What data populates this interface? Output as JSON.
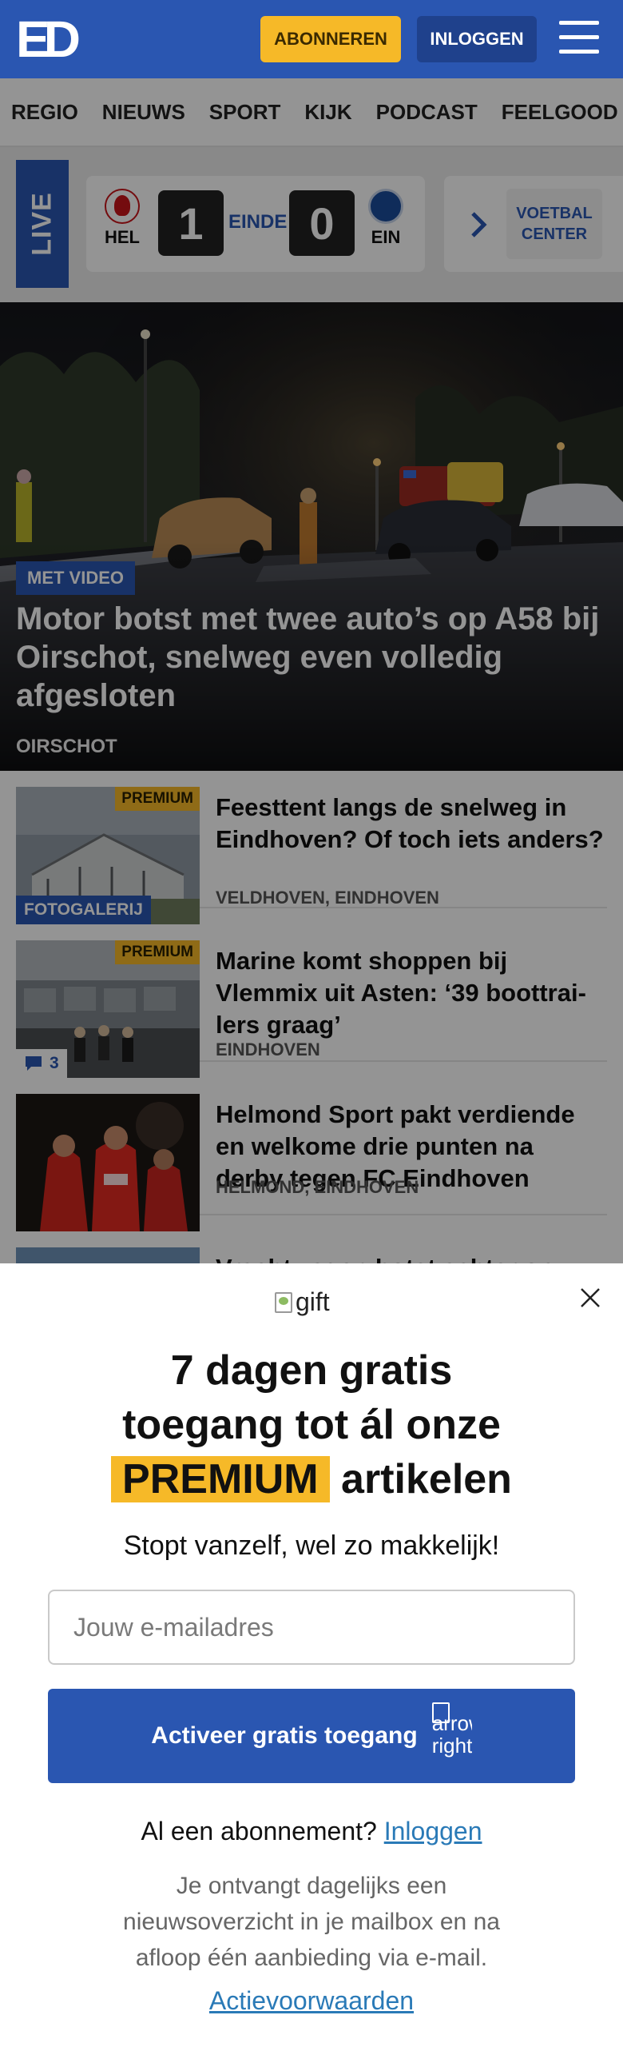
{
  "header": {
    "logo_text": "ED",
    "subscribe_label": "ABONNEREN",
    "login_label": "INLOGGEN",
    "menu_icon": "hamburger-menu-icon"
  },
  "nav": {
    "items": [
      "REGIO",
      "NIEUWS",
      "SPORT",
      "KIJK",
      "PODCAST",
      "FEELGOOD"
    ]
  },
  "live": {
    "label": "LIVE",
    "match": {
      "home_team": "HEL",
      "home_logo_text": "HELMOND SPORT",
      "home_score": "1",
      "status": "EINDE",
      "away_score": "0",
      "away_team": "EIN"
    },
    "center_label": "VOETBAL CENTER"
  },
  "hero": {
    "badge": "MET VIDEO",
    "title": "Motor botst met twee auto’s op A58 bij Oirschot, snelweg even volledig afgesloten",
    "location": "OIRSCHOT"
  },
  "articles": [
    {
      "premium_label": "PREMIUM",
      "thumb_label": "FOTOGALERIJ",
      "title": "Feesttent langs de snelweg in Eindhoven? Of toch iets anders?",
      "meta": "VELDHOVEN, EINDHOVEN"
    },
    {
      "premium_label": "PREMIUM",
      "comment_count": "3",
      "title": "Marine komt shoppen bij Vlemmix uit Asten: ‘39 boottrai­lers graag’",
      "meta": "EINDHOVEN"
    },
    {
      "title": "Helmond Sport pakt verdiende en welkome drie punten na derby tegen FC Eindhoven",
      "meta": "HELMOND, EINDHOVEN"
    },
    {
      "title": "Vrachtwagen botst achter op"
    }
  ],
  "modal": {
    "gift_alt": "gift",
    "heading_line1": "7 dagen gratis",
    "heading_line2": "toegang tot ál onze",
    "heading_highlight": "PREMIUM",
    "heading_tail": " artikelen",
    "subheading": "Stopt vanzelf, wel zo makkelijk!",
    "email_placeholder": "Jouw e-mailadres",
    "cta_label": "Activeer gratis toegang",
    "cta_icon_alt": "arrow-right",
    "login_prompt": "Al een abonnement? ",
    "login_link": "Inloggen",
    "disclaimer": "Je ontvangt dagelijks een nieuwsoverzicht in je mailbox en na afloop één aanbieding via e-mail.",
    "terms_link": "Actievoorwaarden"
  },
  "colors": {
    "brand_blue": "#2a56b1",
    "premium_yellow": "#f6b928",
    "link_blue": "#2a7ab7"
  }
}
